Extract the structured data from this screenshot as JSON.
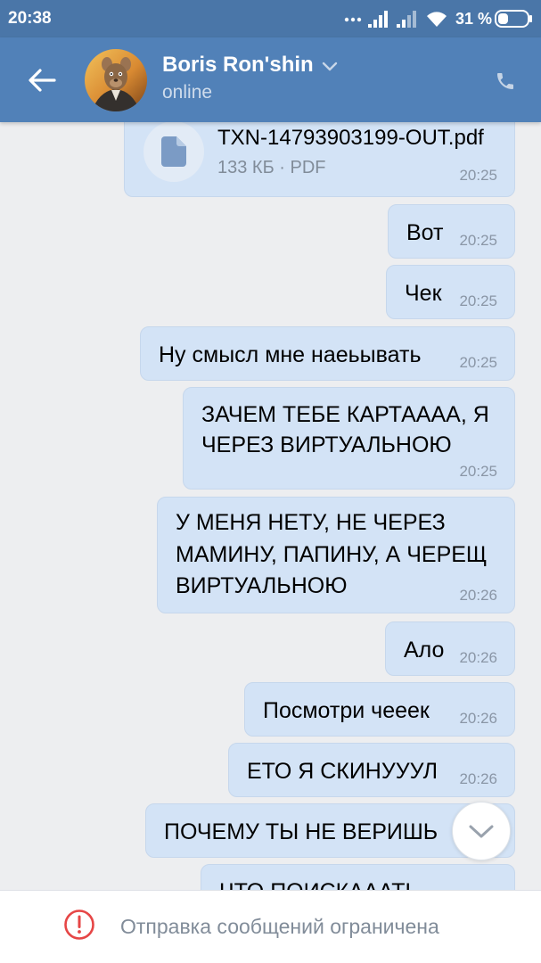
{
  "status_bar": {
    "time": "20:38",
    "battery_level": "31 %",
    "icons": [
      "more-dots-icon",
      "signal-icon",
      "signal-icon",
      "wifi-icon",
      "battery-icon"
    ]
  },
  "header": {
    "contact_name": "Boris Ron'shin",
    "presence": "online",
    "icons": {
      "back": "arrow-left-icon",
      "dropdown": "chevron-down-icon",
      "call": "phone-icon"
    }
  },
  "messages": [
    {
      "file_name": "TXN-14793903199-OUT.pdf",
      "file_meta": "133 КБ · PDF",
      "time": "20:25",
      "icon": "document-icon"
    },
    {
      "lines": [
        "Вот"
      ],
      "time": "20:25"
    },
    {
      "lines": [
        "Чек"
      ],
      "time": "20:25"
    },
    {
      "lines": [
        "Ну смысл мне наеьывать"
      ],
      "time": "20:25"
    },
    {
      "lines": [
        "ЗАЧЕМ ТЕБЕ КАРТАААА, Я",
        "ЧЕРЕЗ ВИРТУАЛЬНОЮ"
      ],
      "time": "20:25"
    },
    {
      "lines": [
        "У МЕНЯ НЕТУ, НЕ ЧЕРЕЗ",
        "МАМИНУ, ПАПИНУ, А ЧЕРЕЩ",
        "ВИРТУАЛЬНОЮ"
      ],
      "time": "20:26"
    },
    {
      "lines": [
        "Ало"
      ],
      "time": "20:26"
    },
    {
      "lines": [
        "Посмотри чееек"
      ],
      "time": "20:26"
    },
    {
      "lines": [
        "ЕТО Я СКИНУУУЛ"
      ],
      "time": "20:26"
    },
    {
      "lines": [
        "ПОЧЕМУ ТЫ НЕ ВЕРИШЬ"
      ]
    },
    {
      "lines": [
        "ЧТО ПОИСКАААТЬ"
      ]
    }
  ],
  "scroll_down": {
    "icon": "chevron-down-icon"
  },
  "composer": {
    "notice_icon": "exclamation-circle-icon",
    "notice": "Отправка сообщений ограничена"
  },
  "colors": {
    "status_bar": "#4a76a8",
    "header": "#5181b8",
    "chat_background": "#edeef0",
    "bubble": "#d3e3f6",
    "bubble_border": "#c6d7ec",
    "time_text": "#8a96a6",
    "presence_text": "#cfdcec",
    "notice_icon": "#e64646",
    "notice_text": "#818c99",
    "file_icon_bg": "#e2ebf6",
    "file_icon": "#7b9bc5"
  }
}
